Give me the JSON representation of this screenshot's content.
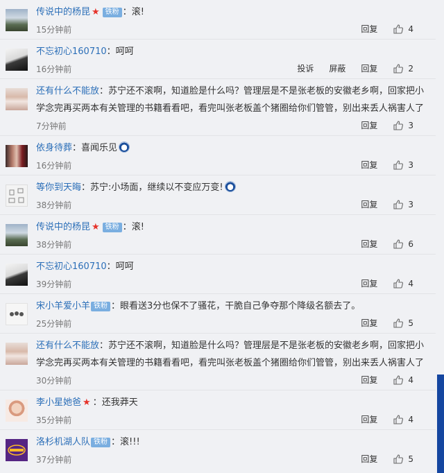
{
  "colors": {
    "username": "#2c6fb8",
    "badge": "#7aaee0",
    "star": "#e6332a"
  },
  "actions": {
    "reply": "回复",
    "report": "投诉",
    "block": "屏蔽"
  },
  "comments": [
    {
      "user": "传说中的杨昆",
      "star": true,
      "badge": "铁粉",
      "sep": "：",
      "text": "滚!",
      "time": "15分钟前",
      "likes": "4"
    },
    {
      "user": "不忘初心160710",
      "sep": "：",
      "text": "呵呵",
      "time": "16分钟前",
      "likes": "2",
      "extra": true
    },
    {
      "user": "还有什么不能放",
      "sep": "：",
      "text": "苏宁还不滚啊，知道脸是什么吗？管理层是不是张老板的安徽老乡啊，回家把小学念完再买两本有关管理的书籍看看吧，看完叫张老板盖个猪圈给你们管管，别出来丢人祸害人了",
      "time": "7分钟前",
      "likes": "3"
    },
    {
      "user": "依身待葬",
      "sep": "：",
      "text": "喜闻乐见",
      "emoji": true,
      "time": "16分钟前",
      "likes": "3"
    },
    {
      "user": "等你到天晦",
      "sep": "：",
      "text": "苏宁:小场面，继续以不变应万变!",
      "emoji": true,
      "time": "38分钟前",
      "likes": "3"
    },
    {
      "user": "传说中的杨昆",
      "star": true,
      "badge": "铁粉",
      "sep": "：",
      "text": "滚!",
      "time": "38分钟前",
      "likes": "6"
    },
    {
      "user": "不忘初心160710",
      "sep": "：",
      "text": "呵呵",
      "time": "39分钟前",
      "likes": "4"
    },
    {
      "user": "宋小羊爱小羊",
      "badge": "铁粉",
      "sep": "：",
      "text": "眼看送3分也保不了骚花，干脆自己争夺那个降级名额去了。",
      "time": "25分钟前",
      "likes": "5"
    },
    {
      "user": "还有什么不能放",
      "sep": "：",
      "text": "苏宁还不滚啊，知道脸是什么吗？管理层是不是张老板的安徽老乡啊，回家把小学念完再买两本有关管理的书籍看看吧，看完叫张老板盖个猪圈给你们管管，别出来丢人祸害人了",
      "time": "30分钟前",
      "likes": "4"
    },
    {
      "user": "李小星她爸",
      "star": true,
      "sep": "：",
      "text": "还我莽天",
      "time": "35分钟前",
      "likes": "4"
    },
    {
      "user": "洛杉机湖人队",
      "badge": "铁粉",
      "sep": "：",
      "text": "滚!!!",
      "time": "37分钟前",
      "likes": "5"
    }
  ]
}
